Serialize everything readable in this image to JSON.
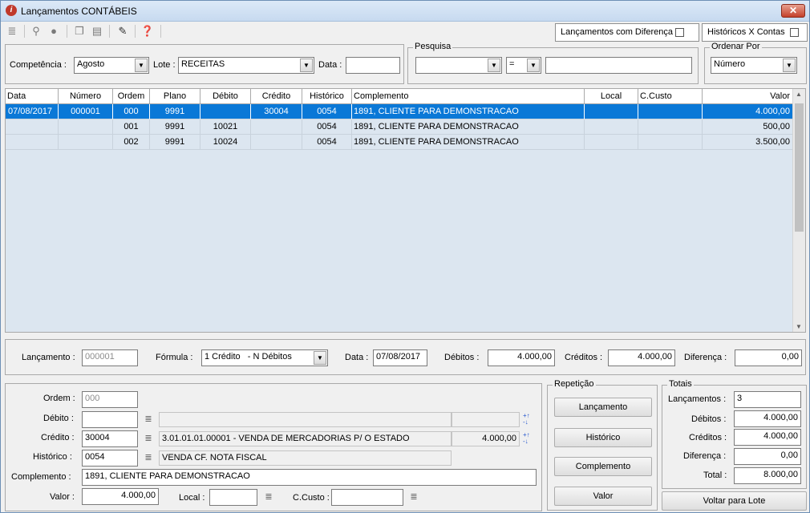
{
  "window": {
    "title": "Lançamentos CONTÁBEIS",
    "close": "✕"
  },
  "toolbar": {
    "icons": [
      "list-icon",
      "search-icon",
      "binoculars-icon",
      "copy-icon",
      "document-icon",
      "edit-icon",
      "help-icon"
    ]
  },
  "options": {
    "lancamentos_diferenca": "Lançamentos com Diferença",
    "historicos_contas": "Históricos X Contas"
  },
  "filter": {
    "competencia_label": "Competência :",
    "competencia_value": "Agosto",
    "lote_label": "Lote :",
    "lote_value": "RECEITAS",
    "data_label": "Data :",
    "data_value": ""
  },
  "pesquisa": {
    "title": "Pesquisa",
    "field_value": "",
    "operator_value": "=",
    "search_value": ""
  },
  "ordenar": {
    "title": "Ordenar Por",
    "value": "Número"
  },
  "grid": {
    "columns": [
      "Data",
      "Número",
      "Ordem",
      "Plano",
      "Débito",
      "Crédito",
      "Histórico",
      "Complemento",
      "Local",
      "C.Custo",
      "Valor"
    ],
    "rows": [
      [
        "07/08/2017",
        "000001",
        "000",
        "9991",
        "",
        "30004",
        "0054",
        "1891, CLIENTE PARA DEMONSTRACAO",
        "",
        "",
        "4.000,00"
      ],
      [
        "",
        "",
        "001",
        "9991",
        "10021",
        "",
        "0054",
        "1891, CLIENTE PARA DEMONSTRACAO",
        "",
        "",
        "500,00"
      ],
      [
        "",
        "",
        "002",
        "9991",
        "10024",
        "",
        "0054",
        "1891, CLIENTE PARA DEMONSTRACAO",
        "",
        "",
        "3.500,00"
      ]
    ]
  },
  "summary": {
    "lancamento_label": "Lançamento :",
    "lancamento_value": "000001",
    "formula_label": "Fórmula :",
    "formula_value": "1 Crédito   - N Débitos",
    "data_label": "Data :",
    "data_value": "07/08/2017",
    "debitos_label": "Débitos :",
    "debitos_value": "4.000,00",
    "creditos_label": "Créditos :",
    "creditos_value": "4.000,00",
    "diferenca_label": "Diferença :",
    "diferenca_value": "0,00"
  },
  "detail": {
    "ordem_label": "Ordem :",
    "ordem_value": "000",
    "debito_label": "Débito :",
    "debito_value": "",
    "debito_desc": "",
    "debito_amount": "",
    "credito_label": "Crédito :",
    "credito_value": "30004",
    "credito_desc": "3.01.01.01.00001 - VENDA DE MERCADORIAS P/ O ESTADO",
    "credito_amount": "4.000,00",
    "historico_label": "Histórico :",
    "historico_value": "0054",
    "historico_desc": "VENDA CF. NOTA FISCAL",
    "complemento_label": "Complemento :",
    "complemento_value": "1891, CLIENTE PARA DEMONSTRACAO",
    "valor_label": "Valor :",
    "valor_value": "4.000,00",
    "local_label": "Local :",
    "local_value": "",
    "ccusto_label": "C.Custo :",
    "ccusto_value": ""
  },
  "repeticao": {
    "title": "Repetição",
    "buttons": [
      "Lançamento",
      "Histórico",
      "Complemento",
      "Valor"
    ]
  },
  "totais": {
    "title": "Totais",
    "lancamentos_label": "Lançamentos :",
    "lancamentos_value": "3",
    "debitos_label": "Débitos :",
    "debitos_value": "4.000,00",
    "creditos_label": "Créditos :",
    "creditos_value": "4.000,00",
    "diferenca_label": "Diferença :",
    "diferenca_value": "0,00",
    "total_label": "Total :",
    "total_value": "8.000,00"
  },
  "voltar_label": "Voltar para Lote"
}
